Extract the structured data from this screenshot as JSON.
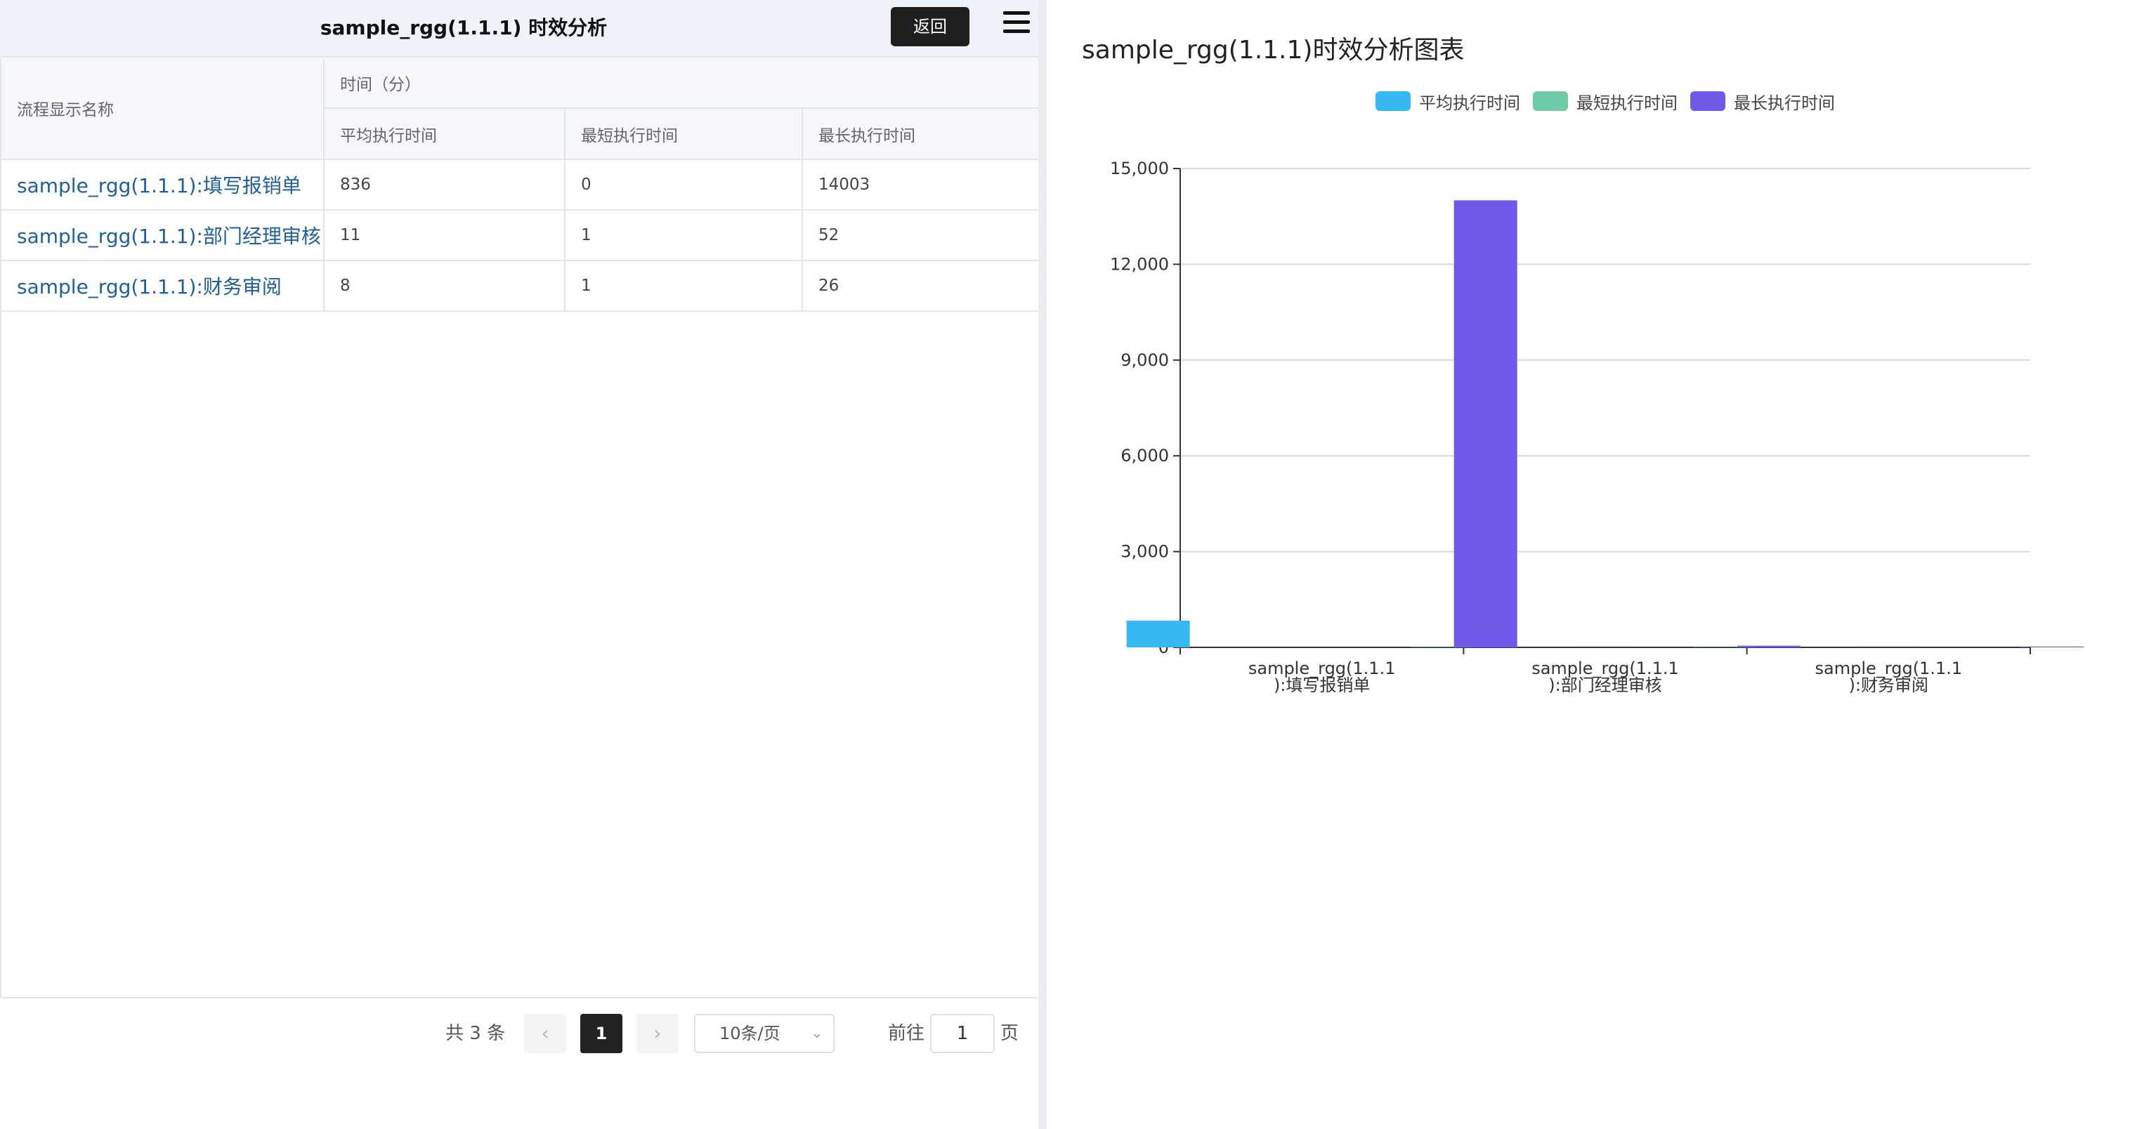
{
  "header": {
    "title": "sample_rgg(1.1.1) 时效分析",
    "back_label": "返回"
  },
  "table": {
    "name_header": "流程显示名称",
    "group_header": "时间（分）",
    "col_avg": "平均执行时间",
    "col_min": "最短执行时间",
    "col_max": "最长执行时间",
    "rows": [
      {
        "name": "sample_rgg(1.1.1):填写报销单",
        "avg": "836",
        "min": "0",
        "max": "14003"
      },
      {
        "name": "sample_rgg(1.1.1):部门经理审核",
        "avg": "11",
        "min": "1",
        "max": "52"
      },
      {
        "name": "sample_rgg(1.1.1):财务审阅",
        "avg": "8",
        "min": "1",
        "max": "26"
      }
    ]
  },
  "pagination": {
    "total_label": "共 3 条",
    "prev_icon": "chevron-left-icon",
    "next_icon": "chevron-right-icon",
    "current_page": "1",
    "page_size": "10条/页",
    "goto_label": "前往",
    "goto_value": "1",
    "page_suffix": "页"
  },
  "icons": {
    "menu": "hamburger-menu-icon",
    "dropdown": "chevron-down-icon"
  },
  "chart_data": {
    "type": "bar",
    "title": "sample_rgg(1.1.1)时效分析图表",
    "categories": [
      "sample_rgg(1.1.1):填写报销单",
      "sample_rgg(1.1.1):部门经理审核",
      "sample_rgg(1.1.1):财务审阅"
    ],
    "category_label_lines": [
      [
        "sample_rgg(1.1.1",
        "):填写报销单"
      ],
      [
        "sample_rgg(1.1.1",
        "):部门经理审核"
      ],
      [
        "sample_rgg(1.1.1",
        "):财务审阅"
      ]
    ],
    "series": [
      {
        "name": "平均执行时间",
        "color": "#36b8f5",
        "values": [
          836,
          11,
          8
        ]
      },
      {
        "name": "最短执行时间",
        "color": "#6ccba5",
        "values": [
          0,
          1,
          1
        ]
      },
      {
        "name": "最长执行时间",
        "color": "#7258ea",
        "values": [
          14003,
          52,
          26
        ]
      }
    ],
    "ylim": [
      0,
      15000
    ],
    "yticks": [
      0,
      3000,
      6000,
      9000,
      12000,
      15000
    ],
    "ytick_labels": [
      "0",
      "3,000",
      "6,000",
      "9,000",
      "12,000",
      "15,000"
    ],
    "grid": true,
    "legend_position": "top-center",
    "xlabel": "",
    "ylabel": ""
  }
}
